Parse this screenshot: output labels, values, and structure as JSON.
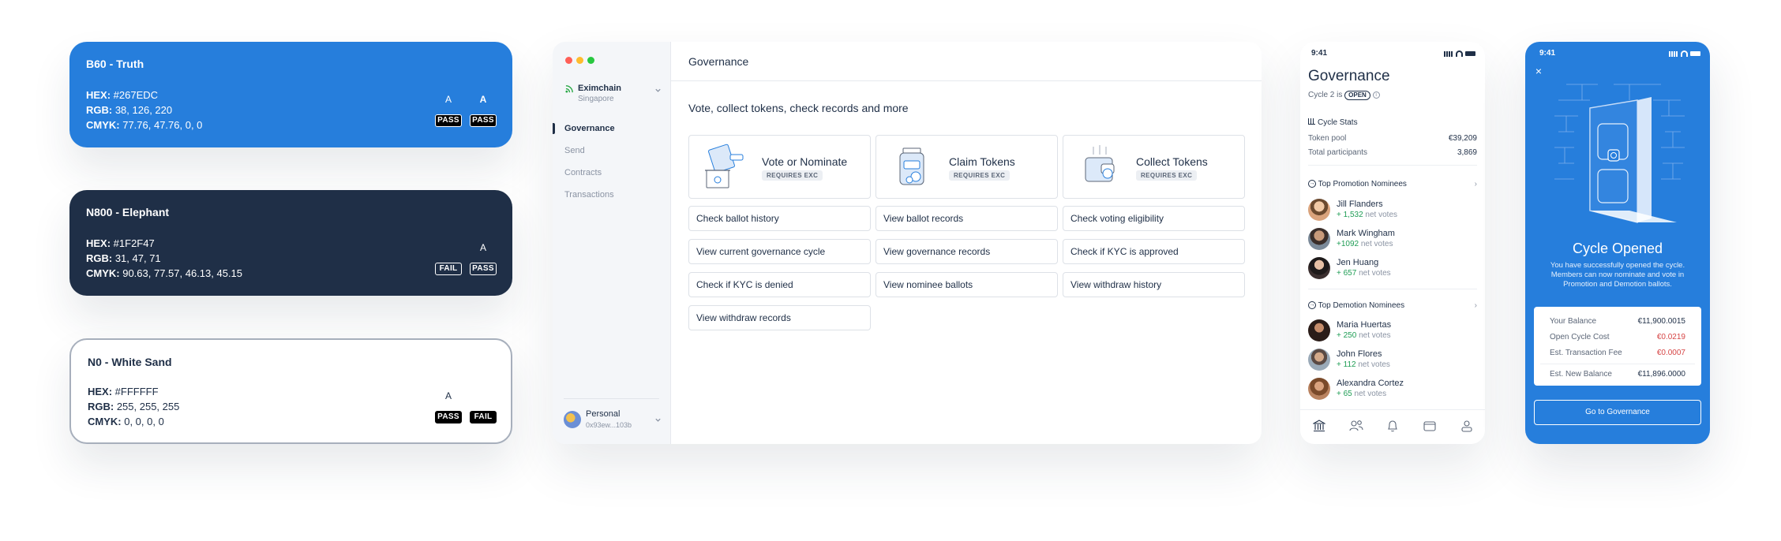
{
  "colors": {
    "truth": "#267EDC",
    "elephant": "#1F2F47",
    "white_sand": "#FFFFFF",
    "positive": "#1F9D55",
    "negative": "#D64545"
  },
  "swatches": [
    {
      "title": "B60 - Truth",
      "hex_label": "HEX:",
      "hex": " #267EDC",
      "rgb_label": "RGB:",
      "rgb": " 38, 126, 220",
      "cmyk_label": "CMYK:",
      "cmyk": " 77.76, 47.76, 0, 0",
      "contrast": [
        {
          "letter": "A",
          "result": "PASS"
        },
        {
          "letter": "A",
          "result": "PASS"
        }
      ]
    },
    {
      "title": "N800 - Elephant",
      "hex_label": "HEX:",
      "hex": " #1F2F47",
      "rgb_label": "RGB:",
      "rgb": " 31, 47, 71",
      "cmyk_label": "CMYK:",
      "cmyk": " 90.63, 77.57, 46.13, 45.15",
      "contrast": [
        {
          "letter": "",
          "result": "FAIL"
        },
        {
          "letter": "A",
          "result": "PASS"
        }
      ]
    },
    {
      "title": "N0 - White Sand",
      "hex_label": "HEX:",
      "hex": " #FFFFFF",
      "rgb_label": "RGB:",
      "rgb": " 255, 255, 255",
      "cmyk_label": "CMYK:",
      "cmyk": " 0, 0, 0, 0",
      "contrast": [
        {
          "letter": "A",
          "result": "PASS"
        },
        {
          "letter": "",
          "result": "FAIL"
        }
      ]
    }
  ],
  "desktop": {
    "org": {
      "name": "Eximchain",
      "location": "Singapore"
    },
    "nav": [
      "Governance",
      "Send",
      "Contracts",
      "Transactions"
    ],
    "account": {
      "name": "Personal",
      "address": "0x93ew...103b"
    },
    "header_title": "Governance",
    "subtitle": "Vote, collect tokens, check records and more",
    "actions": [
      {
        "title": "Vote or Nominate",
        "badge": "REQUIRES EXC"
      },
      {
        "title": "Claim Tokens",
        "badge": "REQUIRES EXC"
      },
      {
        "title": "Collect Tokens",
        "badge": "REQUIRES EXC"
      }
    ],
    "links": [
      "Check ballot history",
      "View ballot records",
      "Check voting eligibility",
      "View current governance cycle",
      "View governance records",
      "Check if KYC is approved",
      "Check if KYC is denied",
      "View nominee ballots",
      "View withdraw history",
      "View withdraw records"
    ]
  },
  "phone1": {
    "time": "9:41",
    "title": "Governance",
    "cycle_prefix": "Cycle 2 is",
    "cycle_status": "OPEN",
    "stats_title": "Cycle Stats",
    "stats": [
      {
        "label": "Token pool",
        "value": "€39,209"
      },
      {
        "label": "Total participants",
        "value": "3,869"
      }
    ],
    "promotion_title": "Top Promotion Nominees",
    "promotion": [
      {
        "name": "Jill Flanders",
        "votes": "+ 1,532",
        "suffix": " net votes"
      },
      {
        "name": "Mark Wingham",
        "votes": "+1092",
        "suffix": " net votes"
      },
      {
        "name": "Jen Huang",
        "votes": "+ 657",
        "suffix": " net votes"
      }
    ],
    "demotion_title": "Top Demotion Nominees",
    "demotion": [
      {
        "name": "Maria Huertas",
        "votes": "+ 250",
        "suffix": " net votes"
      },
      {
        "name": "John Flores",
        "votes": "+ 112",
        "suffix": " net votes"
      },
      {
        "name": "Alexandra Cortez",
        "votes": "+ 65",
        "suffix": " net votes"
      }
    ],
    "tab_icons": [
      "bank-icon",
      "people-icon",
      "bell-icon",
      "wallet-icon",
      "profile-icon"
    ]
  },
  "phone2": {
    "time": "9:41",
    "title": "Cycle Opened",
    "message": "You have successfully opened the cycle. Members can now nominate and vote in Promotion and Demotion ballots.",
    "rows": [
      {
        "label": "Your Balance",
        "value": "€11,900.0015"
      },
      {
        "label": "Open Cycle Cost",
        "value": "€0.0219"
      },
      {
        "label": "Est. Transaction Fee",
        "value": "€0.0007"
      },
      {
        "label": "Est. New Balance",
        "value": "€11,896.0000"
      }
    ],
    "button": "Go to Governance"
  }
}
